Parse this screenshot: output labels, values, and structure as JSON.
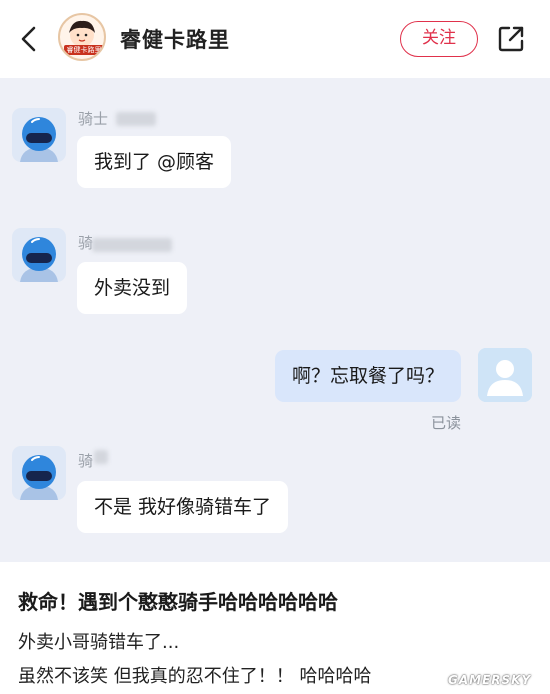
{
  "header": {
    "shop_name": "睿健卡路里",
    "logo_text": "睿健卡路里",
    "follow_label": "关注",
    "icons": {
      "back": "chevron-left-icon",
      "share": "share-external-icon"
    }
  },
  "chat": {
    "messages": [
      {
        "sender": "rider",
        "name": "骑士",
        "text": "我到了 @顾客"
      },
      {
        "sender": "rider",
        "name": "骑",
        "text": "外卖没到"
      },
      {
        "sender": "user",
        "text": "啊？忘取餐了吗？",
        "status": "已读"
      },
      {
        "sender": "rider",
        "name": "骑",
        "text": "不是 我好像骑错车了"
      }
    ]
  },
  "post": {
    "title": "救命！遇到个憨憨骑手哈哈哈哈哈哈",
    "lines": [
      "外卖小哥骑错车了...",
      "虽然不该笑 但我真的忍不住了！！ 哈哈哈哈"
    ]
  },
  "watermark": "GAMERSKY",
  "colors": {
    "accent": "#e0314b",
    "chat_bg": "#eef0f7",
    "bubble_out": "#d9e6fb",
    "helmet": "#2f86dc"
  }
}
